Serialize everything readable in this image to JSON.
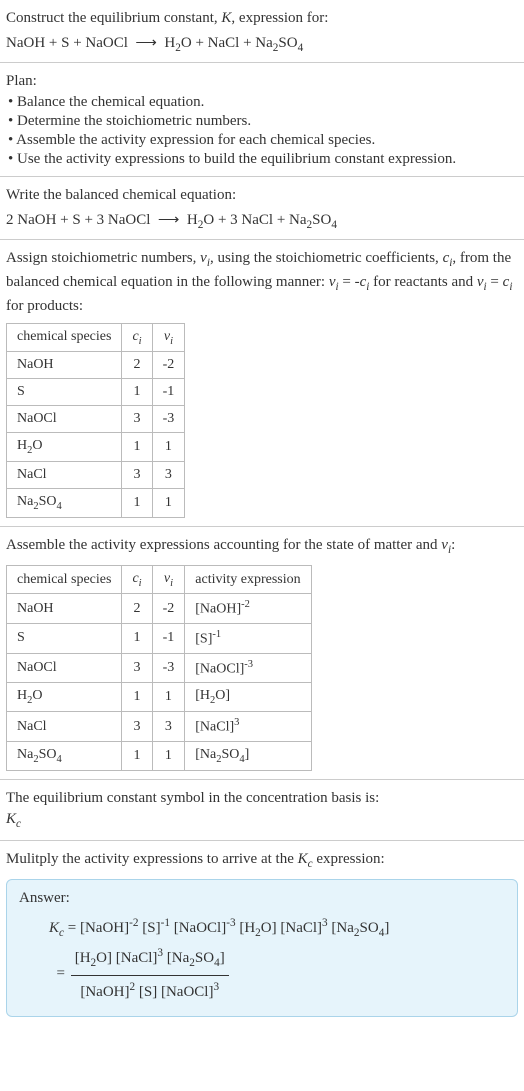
{
  "header": {
    "title_prefix": "Construct the equilibrium constant, ",
    "title_k": "K",
    "title_suffix": ", expression for:"
  },
  "plan": {
    "title": "Plan:",
    "b1": "• Balance the chemical equation.",
    "b2": "• Determine the stoichiometric numbers.",
    "b3": "• Assemble the activity expression for each chemical species.",
    "b4": "• Use the activity expressions to build the equilibrium constant expression."
  },
  "balanced": {
    "title": "Write the balanced chemical equation:"
  },
  "assign": {
    "p1": "Assign stoichiometric numbers, ",
    "p2": ", using the stoichiometric coefficients, ",
    "p3": ", from the balanced chemical equation in the following manner: ",
    "p4": " for reactants and ",
    "p5": " for products:"
  },
  "table1": {
    "h1": "chemical species",
    "h2_c": "c",
    "h3_c": "ν",
    "rows": [
      {
        "s": "NaOH",
        "c": "2",
        "v": "-2"
      },
      {
        "s": "S",
        "c": "1",
        "v": "-1"
      },
      {
        "s": "NaOCl",
        "c": "3",
        "v": "-3"
      },
      {
        "s": "H2O",
        "c": "1",
        "v": "1"
      },
      {
        "s": "NaCl",
        "c": "3",
        "v": "3"
      },
      {
        "s": "Na2SO4",
        "c": "1",
        "v": "1"
      }
    ]
  },
  "assemble_text_prefix": "Assemble the activity expressions accounting for the state of matter and ",
  "assemble_text_suffix": ":",
  "table2": {
    "h1": "chemical species",
    "h2_c": "c",
    "h3_c": "ν",
    "h4": "activity expression",
    "rows": [
      {
        "s": "NaOH",
        "c": "2",
        "v": "-2"
      },
      {
        "s": "S",
        "c": "1",
        "v": "-1"
      },
      {
        "s": "NaOCl",
        "c": "3",
        "v": "-3"
      },
      {
        "s": "H2O",
        "c": "1",
        "v": "1"
      },
      {
        "s": "NaCl",
        "c": "3",
        "v": "3"
      },
      {
        "s": "Na2SO4",
        "c": "1",
        "v": "1"
      }
    ]
  },
  "kc_symbol": {
    "line": "The equilibrium constant symbol in the concentration basis is:",
    "k": "K",
    "c": "c"
  },
  "multiply": {
    "prefix": "Mulitply the activity expressions to arrive at the ",
    "k": "K",
    "c": "c",
    "suffix": " expression:"
  },
  "answer": {
    "title": "Answer:"
  },
  "chart_data": {
    "type": "table",
    "title": "Stoichiometric numbers and activity expressions",
    "tables": [
      {
        "columns": [
          "chemical species",
          "c_i",
          "ν_i"
        ],
        "rows": [
          [
            "NaOH",
            2,
            -2
          ],
          [
            "S",
            1,
            -1
          ],
          [
            "NaOCl",
            3,
            -3
          ],
          [
            "H2O",
            1,
            1
          ],
          [
            "NaCl",
            3,
            3
          ],
          [
            "Na2SO4",
            1,
            1
          ]
        ]
      },
      {
        "columns": [
          "chemical species",
          "c_i",
          "ν_i",
          "activity expression"
        ],
        "rows": [
          [
            "NaOH",
            2,
            -2,
            "[NaOH]^-2"
          ],
          [
            "S",
            1,
            -1,
            "[S]^-1"
          ],
          [
            "NaOCl",
            3,
            -3,
            "[NaOCl]^-3"
          ],
          [
            "H2O",
            1,
            1,
            "[H2O]"
          ],
          [
            "NaCl",
            3,
            3,
            "[NaCl]^3"
          ],
          [
            "Na2SO4",
            1,
            1,
            "[Na2SO4]"
          ]
        ]
      }
    ],
    "unbalanced_equation": "NaOH + S + NaOCl ⟶ H2O + NaCl + Na2SO4",
    "balanced_equation": "2 NaOH + S + 3 NaOCl ⟶ H2O + 3 NaCl + Na2SO4",
    "Kc_expression": "Kc = [NaOH]^-2 [S]^-1 [NaOCl]^-3 [H2O] [NaCl]^3 [Na2SO4] = ([H2O][NaCl]^3[Na2SO4]) / ([NaOH]^2 [S] [NaOCl]^3)"
  }
}
